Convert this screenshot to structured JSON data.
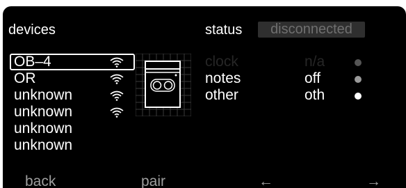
{
  "devices_header": "devices",
  "status_header": "status",
  "status_badge": "disconnected",
  "devices": [
    {
      "name": "OB–4",
      "wifi": true,
      "selected": true
    },
    {
      "name": "OR",
      "wifi": true,
      "selected": false
    },
    {
      "name": "unknown",
      "wifi": true,
      "selected": false
    },
    {
      "name": "unknown",
      "wifi": true,
      "selected": false
    },
    {
      "name": "unknown",
      "wifi": false,
      "selected": false
    },
    {
      "name": "unknown",
      "wifi": false,
      "selected": false
    }
  ],
  "status_rows": [
    {
      "name": "clock",
      "value": "n/a",
      "name_color": "#262626",
      "value_color": "#262626",
      "dot_color": "#555555"
    },
    {
      "name": "notes",
      "value": "off",
      "name_color": "#ffffff",
      "value_color": "#ffffff",
      "dot_color": "#9a9a9a"
    },
    {
      "name": "other",
      "value": "oth",
      "name_color": "#ffffff",
      "value_color": "#ffffff",
      "dot_color": "#ffffff"
    }
  ],
  "footer": {
    "back_label": "back",
    "pair_label": "pair",
    "prev_arrow": "←",
    "next_arrow": "→"
  },
  "icons": {
    "wifi": "wifi-signal-icon",
    "device_thumbnail": "op1-device-icon"
  }
}
